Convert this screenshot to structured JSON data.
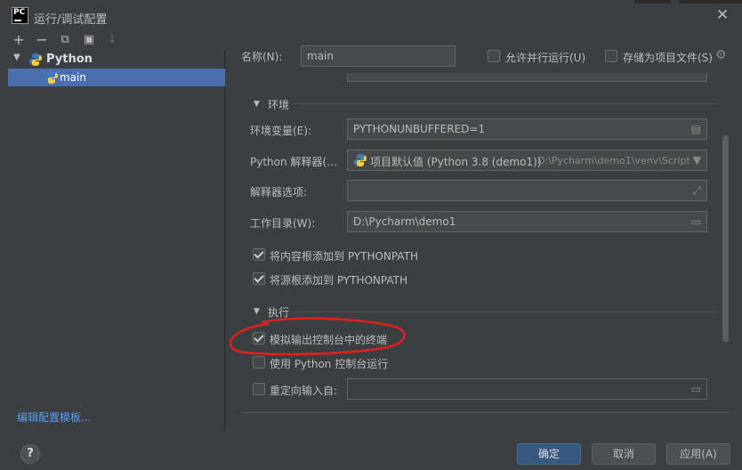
{
  "window": {
    "title": "运行/调试配置",
    "close_glyph": "✕",
    "app_icon_text": "PC"
  },
  "toolbar": {
    "add": "+",
    "remove": "−",
    "copy": "⧉",
    "folder": "▣",
    "sort": "↓"
  },
  "tree": {
    "group_label": "Python",
    "item_label": "main",
    "edit_templates": "编辑配置模板..."
  },
  "header": {
    "name_label": "名称(N):",
    "name_value": "main",
    "allow_parallel": "允许并行运行(U)",
    "store_as_file": "存储为项目文件(S)"
  },
  "env_section": {
    "title": "环境",
    "env_vars_label": "环境变量(E):",
    "env_vars_value": "PYTHONUNBUFFERED=1",
    "interpreter_label": "Python 解释器(…",
    "interpreter_value": "项目默认值 (Python 3.8 (demo1))",
    "interpreter_path": "D:\\Pycharm\\demo1\\venv\\Script",
    "interp_options_label": "解释器选项:",
    "interp_options_value": "",
    "workdir_label": "工作目录(W):",
    "workdir_value": "D:\\Pycharm\\demo1",
    "add_content_roots": "将内容根添加到 PYTHONPATH",
    "add_source_roots": "将源根添加到 PYTHONPATH"
  },
  "exec_section": {
    "title": "执行",
    "emulate_terminal": "模拟输出控制台中的终端",
    "run_with_console": "使用 Python 控制台运行",
    "redirect_input": "重定向输入自:",
    "redirect_value": ""
  },
  "footer": {
    "help": "?",
    "ok": "确定",
    "cancel": "取消",
    "apply": "应用(A)"
  },
  "states": {
    "allow_parallel_checked": false,
    "store_as_file_checked": false,
    "add_content_roots_checked": true,
    "add_source_roots_checked": true,
    "emulate_terminal_checked": true,
    "run_with_console_checked": false,
    "redirect_input_checked": false
  },
  "colors": {
    "background": "#3c3f41",
    "selection": "#4b6eaf",
    "primary_button": "#365880",
    "link": "#589df6",
    "annotation": "#e0201c"
  }
}
